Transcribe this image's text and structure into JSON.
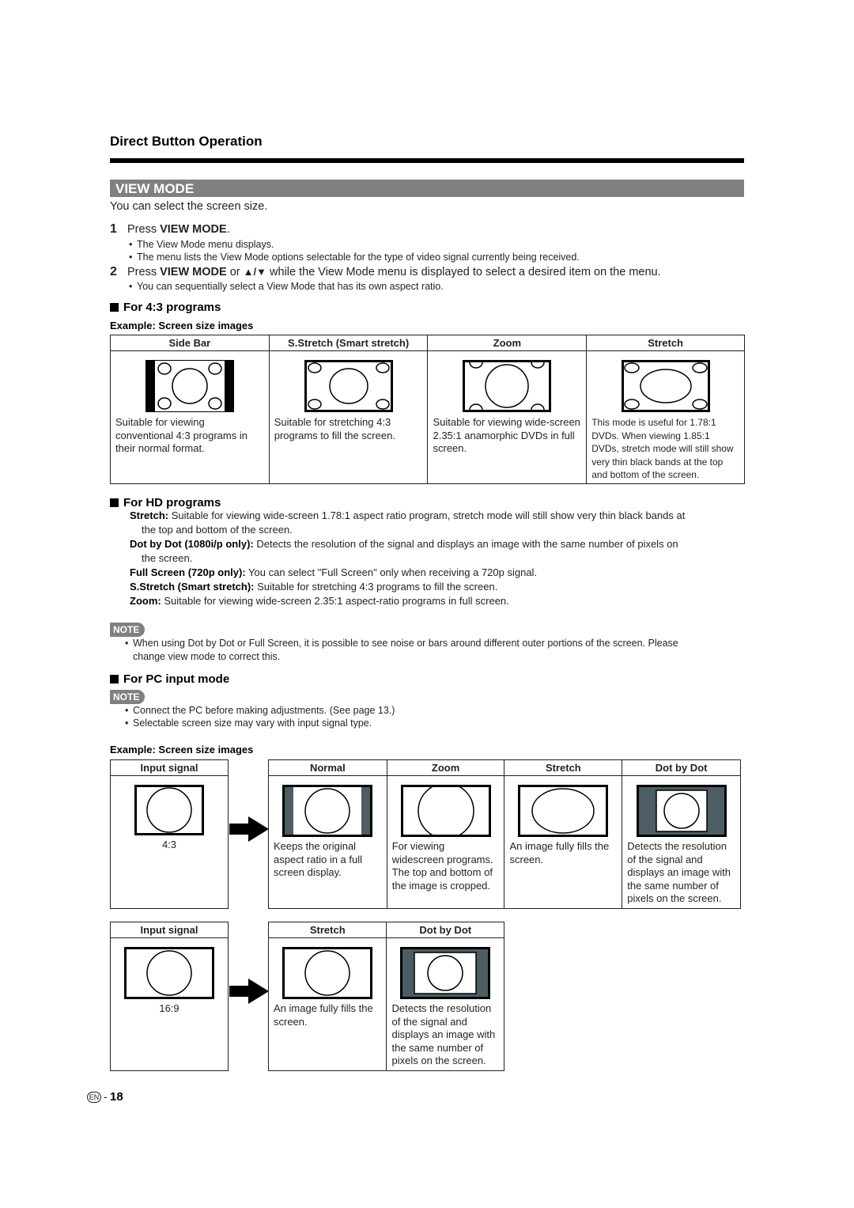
{
  "header": {
    "section_title": "Direct Button Operation",
    "mode_title": "VIEW MODE",
    "intro": "You can select the screen size."
  },
  "steps": [
    {
      "num": "1",
      "prefix": "Press ",
      "bold": "VIEW MODE",
      "suffix": ".",
      "bullets": [
        "The View Mode menu displays.",
        "The menu lists the View Mode options selectable for the type of video signal currently being received."
      ]
    },
    {
      "num": "2",
      "prefix": "Press ",
      "bold": "VIEW MODE",
      "mid": " or ",
      "arrows": "▲/▼",
      "suffix": " while the View Mode menu is displayed to select a desired item on the menu.",
      "bullets": [
        "You can sequentially select a View Mode that has its own aspect ratio."
      ]
    }
  ],
  "for43": {
    "heading": "For 4:3 programs",
    "example_label": "Example: Screen size images",
    "columns": [
      {
        "header": "Side Bar",
        "icon": "side-bar-screen-icon",
        "desc": "Suitable for viewing conventional 4:3 programs in their normal format."
      },
      {
        "header": "S.Stretch (Smart stretch)",
        "icon": "smart-stretch-screen-icon",
        "desc": "Suitable for stretching 4:3 programs to fill the screen."
      },
      {
        "header": "Zoom",
        "icon": "zoom-screen-icon",
        "desc": "Suitable for viewing wide-screen 2.35:1 anamorphic DVDs in full screen."
      },
      {
        "header": "Stretch",
        "icon": "stretch-screen-icon",
        "desc": "This mode is useful for 1.78:1 DVDs. When viewing 1.85:1 DVDs, stretch mode will still show very thin black bands at the top and bottom of the screen."
      }
    ]
  },
  "forHD": {
    "heading": "For HD programs",
    "items": [
      {
        "label": "Stretch:",
        "text": " Suitable for viewing wide-screen 1.78:1 aspect ratio program, stretch mode will still show very thin black bands at",
        "cont": "the top and bottom of the screen."
      },
      {
        "label": "Dot by Dot (1080i/p only):",
        "text": " Detects the resolution of the signal and displays an image with the same number of pixels on",
        "cont": "the screen."
      },
      {
        "label": "Full Screen (720p only):",
        "text": " You can select \"Full Screen\" only when receiving a 720p signal.",
        "cont": ""
      },
      {
        "label": "S.Stretch (Smart stretch):",
        "text": " Suitable for stretching 4:3 programs to fill the screen.",
        "cont": ""
      },
      {
        "label": "Zoom:",
        "text": " Suitable for viewing wide-screen 2.35:1 aspect-ratio programs in full screen.",
        "cont": ""
      }
    ],
    "note_label": "NOTE",
    "note_lines": [
      "When using Dot by Dot or Full Screen, it is possible to see noise or bars around different outer portions of the screen. Please",
      "change view mode to correct this."
    ]
  },
  "forPC": {
    "heading": "For PC input mode",
    "note_label": "NOTE",
    "note_bullets": [
      "Connect the PC before making adjustments. (See page 13.)",
      "Selectable screen size may vary with input signal type."
    ],
    "example_label": "Example: Screen size images",
    "table1": {
      "input_header": "Input signal",
      "input_ratio": "4:3",
      "columns": [
        {
          "header": "Normal",
          "desc": "Keeps the original aspect ratio in a full screen display."
        },
        {
          "header": "Zoom",
          "desc": "For viewing widescreen programs. The top and bottom of the image is cropped."
        },
        {
          "header": "Stretch",
          "desc": "An image fully fills the screen."
        },
        {
          "header": "Dot by Dot",
          "desc": "Detects the resolution of the signal and displays an image with the same number of pixels on the screen."
        }
      ]
    },
    "table2": {
      "input_header": "Input signal",
      "input_ratio": "16:9",
      "columns": [
        {
          "header": "Stretch",
          "desc": "An image fully fills the screen."
        },
        {
          "header": "Dot by Dot",
          "desc": "Detects the resolution of the signal and displays an image with the same number of pixels on the screen."
        }
      ]
    }
  },
  "footer": {
    "lang": "EN",
    "dash": "-",
    "page": "18"
  },
  "colors": {
    "bar_gray": "#808080",
    "dark_slate": "#4d5d63"
  }
}
